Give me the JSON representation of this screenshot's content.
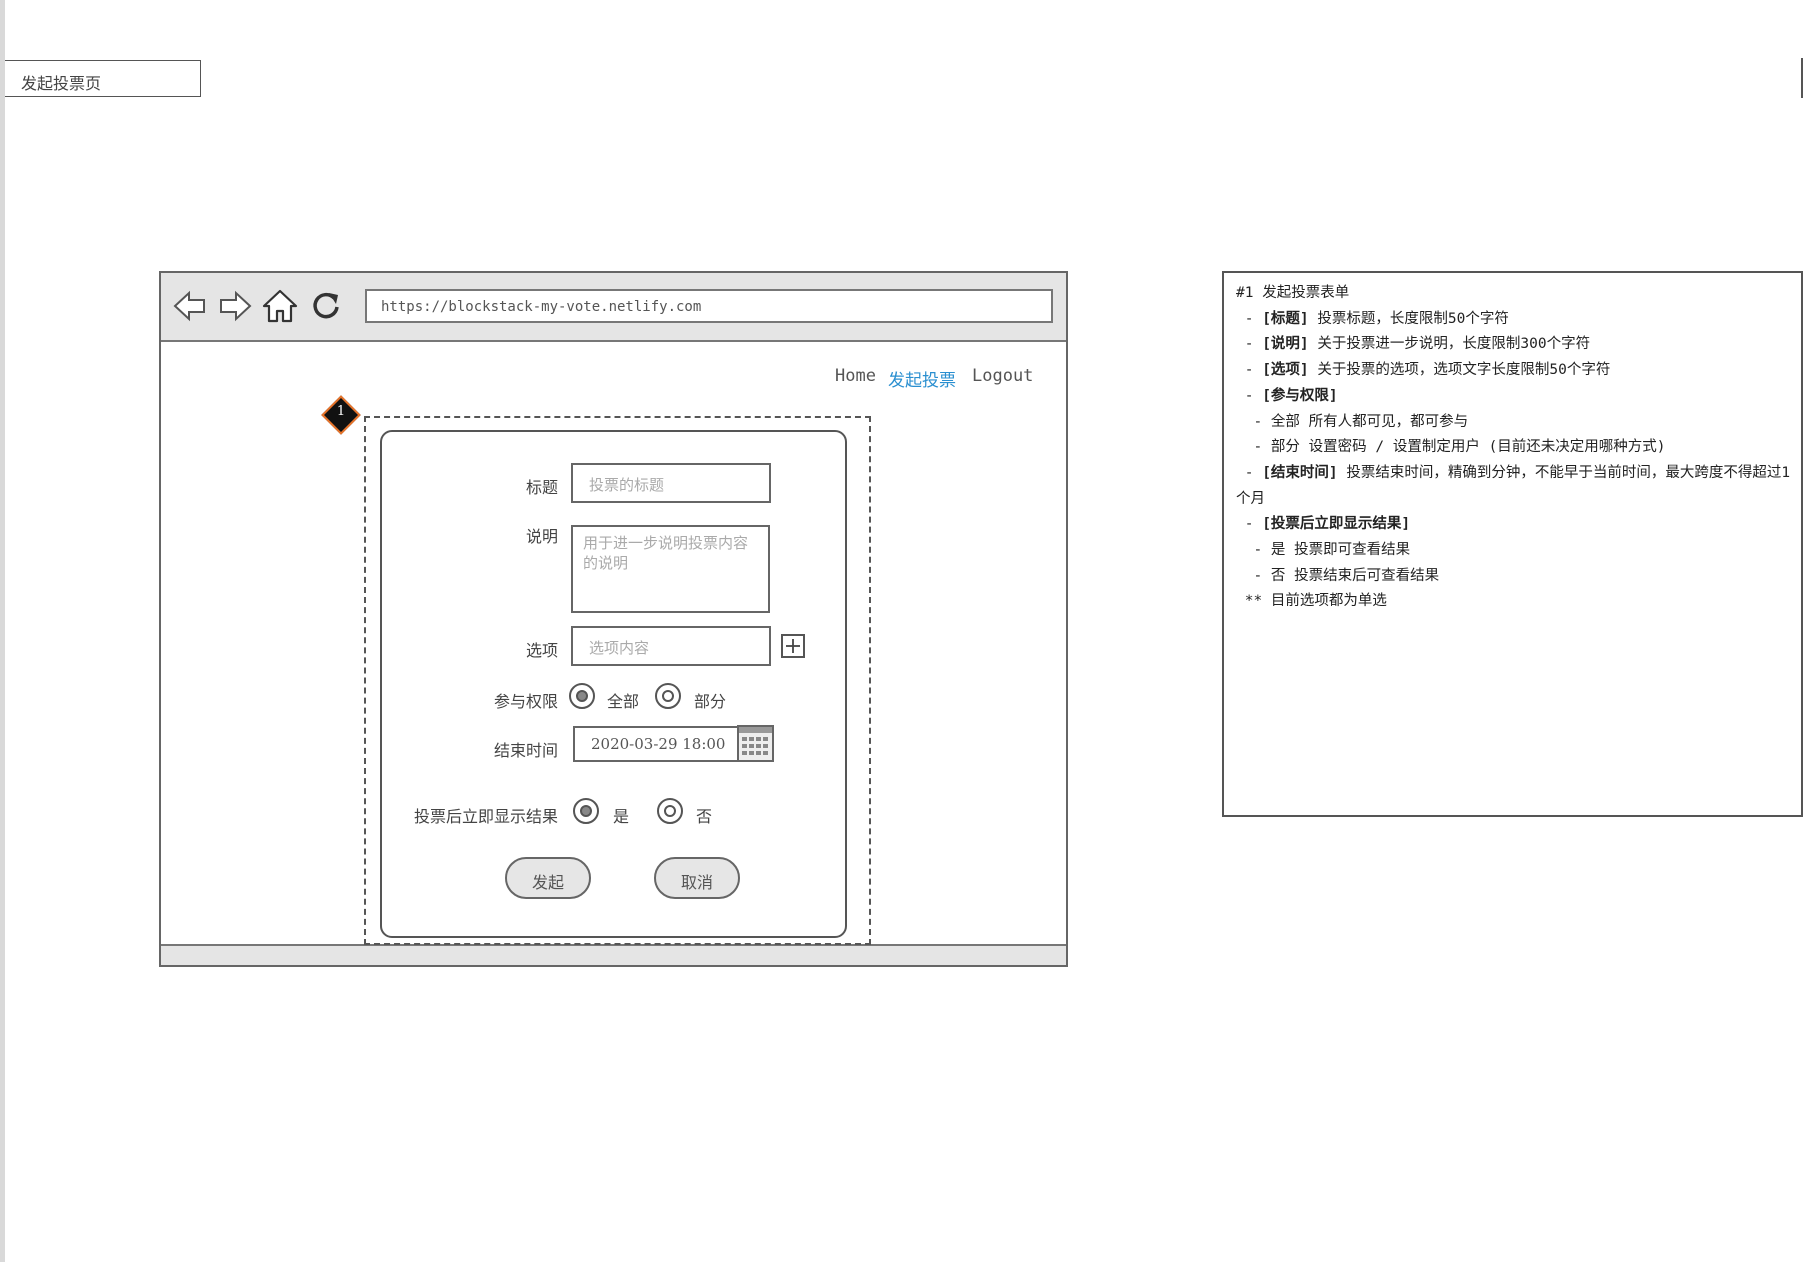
{
  "page_label": "发起投票页",
  "browser": {
    "url": "https://blockstack-my-vote.netlify.com",
    "nav": {
      "home": "Home",
      "create": "发起投票",
      "logout": "Logout"
    }
  },
  "marker": "1",
  "form": {
    "title_label": "标题",
    "title_placeholder": "投票的标题",
    "desc_label": "说明",
    "desc_placeholder": "用于进一步说明投票内容的说明",
    "option_label": "选项",
    "option_placeholder": "选项内容",
    "perm_label": "参与权限",
    "perm_all": "全部",
    "perm_partial": "部分",
    "end_label": "结束时间",
    "end_value": "2020-03-29 18:00",
    "show_label": "投票后立即显示结果",
    "show_yes": "是",
    "show_no": "否",
    "submit": "发起",
    "cancel": "取消"
  },
  "notes": {
    "heading": "#1 发起投票表单",
    "title_tag": "[标题]",
    "title_text": " 投票标题，长度限制50个字符",
    "desc_tag": "[说明]",
    "desc_text": " 关于投票进一步说明，长度限制300个字符",
    "option_tag": "[选项]",
    "option_text": " 关于投票的选项，选项文字长度限制50个字符",
    "perm_tag": "[参与权限]",
    "perm_all": "  - 全部 所有人都可见，都可参与",
    "perm_partial": "  - 部分 设置密码 / 设置制定用户 (目前还未决定用哪种方式)",
    "end_tag": "[结束时间]",
    "end_text": " 投票结束时间，精确到分钟，不能早于当前时间，最大跨度不得超过1个月",
    "show_tag": "[投票后立即显示结果]",
    "show_yes": "  - 是 投票即可查看结果",
    "show_no": "  - 否 投票结束后可查看结果",
    "footnote": " ** 目前选项都为单选"
  }
}
